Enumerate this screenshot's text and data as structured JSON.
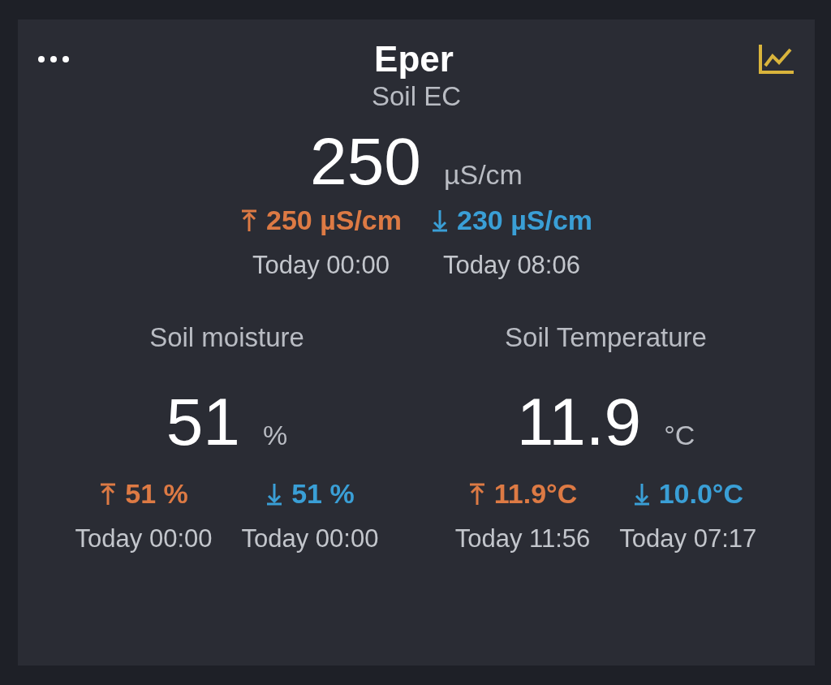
{
  "card": {
    "title": "Eper"
  },
  "sensors": [
    {
      "label": "Soil EC",
      "value": "250",
      "unit": "µS/cm",
      "extremes": [
        {
          "kind": "max",
          "reading": "250 µS/cm",
          "time": "Today 00:00"
        },
        {
          "kind": "min",
          "reading": "230 µS/cm",
          "time": "Today 08:06"
        }
      ]
    },
    {
      "label": "Soil moisture",
      "value": "51",
      "unit": "%",
      "extremes": [
        {
          "kind": "max",
          "reading": "51 %",
          "time": "Today 00:00"
        },
        {
          "kind": "min",
          "reading": "51 %",
          "time": "Today 00:00"
        }
      ]
    },
    {
      "label": "Soil Temperature",
      "value": "11.9",
      "unit": "°C",
      "extremes": [
        {
          "kind": "max",
          "reading": "11.9°C",
          "time": "Today 11:56"
        },
        {
          "kind": "min",
          "reading": "10.0°C",
          "time": "Today 07:17"
        }
      ]
    }
  ]
}
